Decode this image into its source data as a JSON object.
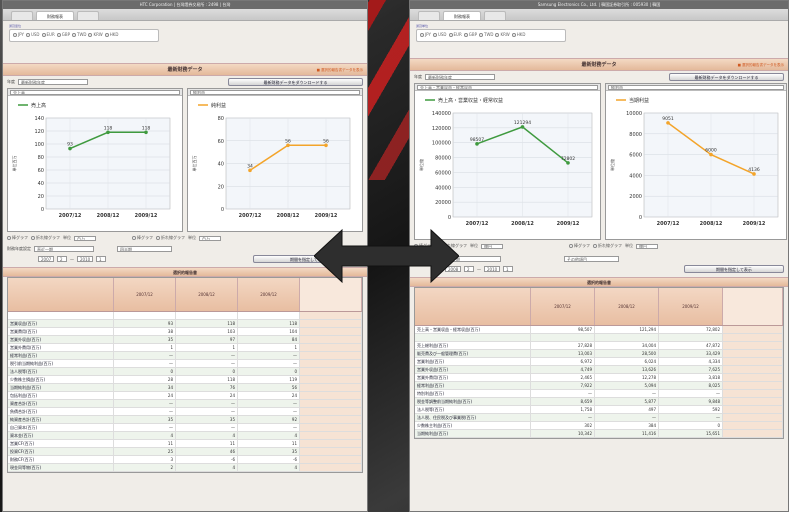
{
  "colors": {
    "green_series": "#3f9a3f",
    "orange_series": "#f3a42a",
    "section_header": "#e6bb9c",
    "arrow": "#2e2e2e"
  },
  "left": {
    "title": "HTC Corporation | 台灣證券交易所 : 2498 | 台灣",
    "tabs": [
      "",
      "財務報表",
      ""
    ],
    "radio_label": "通貨單位",
    "radios": [
      "JPY",
      "USD",
      "EUR",
      "GBP",
      "TWD",
      "KRW",
      "HKD"
    ],
    "section_title": "最新財務データ",
    "section_hint": "■ 選択的報告書データを表示",
    "row_label": "年度",
    "year_select": "最新財務年度",
    "export_button": "最新財務データをダウンロードする",
    "chart_left": {
      "select": "売上高",
      "legend": "売上高",
      "ylabel": "単位百万"
    },
    "chart_right": {
      "select": "純利益",
      "legend": "純利益",
      "ylabel": "単位百万"
    },
    "ctrl_left": [
      "棒グラフ",
      "折れ線グラフ",
      "単位",
      "百万"
    ],
    "ctrl_right": [
      "棒グラフ",
      "折れ線グラフ",
      "単位",
      "百万"
    ],
    "period_label": "財務年度設定",
    "period_select1": "直近一期",
    "period_select2": "四半期",
    "period_from": "2007",
    "period_from_q": "2",
    "period_to": "2010",
    "period_to_q": "1",
    "period_button": "期間を指定して表示",
    "table_title": "選択的報告書",
    "table_cols": [
      "2007/12",
      "2008/12",
      "2009/12"
    ],
    "table_last_col": "",
    "rows": [
      {
        "name": "",
        "v": [
          "",
          "",
          ""
        ]
      },
      {
        "name": "営業収益(百万)",
        "v": [
          "93",
          "118",
          "118"
        ]
      },
      {
        "name": "営業費用(百万)",
        "v": [
          "38",
          "103",
          "104"
        ]
      },
      {
        "name": "営業外収益(百万)",
        "v": [
          "35",
          "97",
          "84"
        ]
      },
      {
        "name": "営業外費用(百万)",
        "v": [
          "1",
          "1",
          "1"
        ]
      },
      {
        "name": "経常利益(百万)",
        "v": [
          "—",
          "—",
          "—"
        ]
      },
      {
        "name": "税引前当期純利益(百万)",
        "v": [
          "—",
          "—",
          "—"
        ]
      },
      {
        "name": "法人税等(百万)",
        "v": [
          "0",
          "0",
          "0"
        ]
      },
      {
        "name": "少数株主損益(百万)",
        "v": [
          "28",
          "118",
          "119"
        ]
      },
      {
        "name": "当期純利益(百万)",
        "v": [
          "34",
          "76",
          "56"
        ]
      },
      {
        "name": "包括利益(百万)",
        "v": [
          "24",
          "24",
          "24"
        ]
      },
      {
        "name": "資産合計(百万)",
        "v": [
          "—",
          "—",
          "—"
        ]
      },
      {
        "name": "負債合計(百万)",
        "v": [
          "—",
          "—",
          "—"
        ]
      },
      {
        "name": "純資産合計(百万)",
        "v": [
          "35",
          "35",
          "92"
        ]
      },
      {
        "name": "自己資本(百万)",
        "v": [
          "—",
          "—",
          "—"
        ]
      },
      {
        "name": "資本金(百万)",
        "v": [
          "4",
          "4",
          "4"
        ]
      },
      {
        "name": "営業CF(百万)",
        "v": [
          "11",
          "11",
          "11"
        ]
      },
      {
        "name": "投資CF(百万)",
        "v": [
          "25",
          "46",
          "35"
        ]
      },
      {
        "name": "財務CF(百万)",
        "v": [
          "3",
          "-6",
          "-6"
        ]
      },
      {
        "name": "現金同等物(百万)",
        "v": [
          "2",
          "4",
          "4"
        ]
      }
    ]
  },
  "right": {
    "title": "Samsung Electronics Co., Ltd. | 韓国証券取引所 : 005930 | 韓国",
    "tabs": [
      "",
      "財務報表",
      ""
    ],
    "radio_label": "通貨単位",
    "radios": [
      "JPY",
      "USD",
      "EUR",
      "GBP",
      "TWD",
      "KRW",
      "HKD"
    ],
    "section_title": "最新財務データ",
    "section_hint": "■ 選択的報告書データを表示",
    "row_label": "年度",
    "year_select": "最新財務年度",
    "export_button": "最新財務データをダウンロードする",
    "chart_left": {
      "select": "売上高・営業収益・経常収益",
      "legend": "売上高・営業収益・経常収益",
      "ylabel": "単位億"
    },
    "chart_right": {
      "select": "純利益",
      "legend": "当期利益",
      "ylabel": "単位億"
    },
    "ctrl_left": [
      "棒グラフ",
      "折れ線グラフ",
      "単位",
      "億円"
    ],
    "ctrl_right": [
      "棒グラフ",
      "折れ線グラフ",
      "単位",
      "億円"
    ],
    "period_label": "財務年度設定",
    "period_select1": "直近一期",
    "period_select2": "その他項目",
    "period_from": "2008",
    "period_from_q": "2",
    "period_to": "2010",
    "period_to_q": "1",
    "period_button": "期間を指定して表示",
    "table_title": "選択的報告書",
    "table_cols": [
      "2007/12",
      "2008/12",
      "2009/12"
    ],
    "table_last_col": "",
    "rows": [
      {
        "name": "売上高・営業収益・経常収益(百万)",
        "v": [
          "98,507",
          "121,294",
          "72,802"
        ]
      },
      {
        "name": "",
        "v": [
          "",
          "",
          ""
        ]
      },
      {
        "name": "売上総利益(百万)",
        "v": [
          "27,828",
          "34,004",
          "47,872"
        ]
      },
      {
        "name": "販売費及び一般管理費(百万)",
        "v": [
          "13,003",
          "28,500",
          "33,429"
        ]
      },
      {
        "name": "営業利益(百万)",
        "v": [
          "6,972",
          "6,024",
          "4,334"
        ]
      },
      {
        "name": "営業外収益(百万)",
        "v": [
          "4,749",
          "13,626",
          "7,625"
        ]
      },
      {
        "name": "営業外費用(百万)",
        "v": [
          "2,465",
          "12,278",
          "3,818"
        ]
      },
      {
        "name": "経常利益(百万)",
        "v": [
          "7,922",
          "5,094",
          "8,025"
        ]
      },
      {
        "name": "特別利益(百万)",
        "v": [
          "—",
          "—",
          "—"
        ]
      },
      {
        "name": "税金等調整前当期純利益(百万)",
        "v": [
          "8,659",
          "5,877",
          "9,848"
        ]
      },
      {
        "name": "法人税等(百万)",
        "v": [
          "1,758",
          "497",
          "592"
        ]
      },
      {
        "name": "法人税、住民税及び事業税(百万)",
        "v": [
          "—",
          "—",
          "—"
        ]
      },
      {
        "name": "少数株主利益(百万)",
        "v": [
          "302",
          "384",
          "0"
        ]
      },
      {
        "name": "当期純利益(百万)",
        "v": [
          "10,342",
          "11,416",
          "15,651"
        ]
      }
    ]
  },
  "chart_data": [
    {
      "type": "line",
      "title": "",
      "series": [
        {
          "name": "売上高",
          "values": [
            93,
            118,
            118
          ]
        }
      ],
      "categories": [
        "2007/12",
        "2008/12",
        "2009/12"
      ],
      "xlabel": "",
      "ylabel": "単位百万",
      "ylim": [
        0,
        140
      ],
      "yticks": [
        0,
        20,
        40,
        60,
        80,
        100,
        120,
        140
      ],
      "data_labels": [
        "93",
        "118",
        "118"
      ],
      "grid": true,
      "legend": "top-left"
    },
    {
      "type": "line",
      "title": "",
      "series": [
        {
          "name": "純利益",
          "values": [
            34,
            56,
            56
          ]
        }
      ],
      "categories": [
        "2007/12",
        "2008/12",
        "2009/12"
      ],
      "xlabel": "",
      "ylabel": "単位百万",
      "ylim": [
        0,
        80
      ],
      "yticks": [
        0,
        20,
        40,
        60,
        80
      ],
      "data_labels": [
        "34",
        "56",
        "56"
      ],
      "grid": true,
      "legend": "top-left"
    },
    {
      "type": "line",
      "title": "",
      "series": [
        {
          "name": "売上高・営業収益・経常収益",
          "values": [
            98507,
            121294,
            72802
          ]
        }
      ],
      "categories": [
        "2007/12",
        "2008/12",
        "2009/12"
      ],
      "xlabel": "",
      "ylabel": "単位億",
      "ylim": [
        0,
        140000
      ],
      "yticks": [
        0,
        20000,
        40000,
        60000,
        80000,
        100000,
        120000,
        140000
      ],
      "data_labels": [
        "98507",
        "121294",
        "72802"
      ],
      "grid": true,
      "legend": "top-left"
    },
    {
      "type": "line",
      "title": "",
      "series": [
        {
          "name": "当期利益",
          "values": [
            9051,
            6000,
            4136
          ]
        }
      ],
      "categories": [
        "2007/12",
        "2008/12",
        "2009/12"
      ],
      "xlabel": "",
      "ylabel": "単位億",
      "ylim": [
        0,
        10000
      ],
      "yticks": [
        0,
        2000,
        4000,
        6000,
        8000,
        10000
      ],
      "data_labels": [
        "9051",
        "6000",
        "4136"
      ],
      "grid": true,
      "legend": "top-left"
    }
  ]
}
